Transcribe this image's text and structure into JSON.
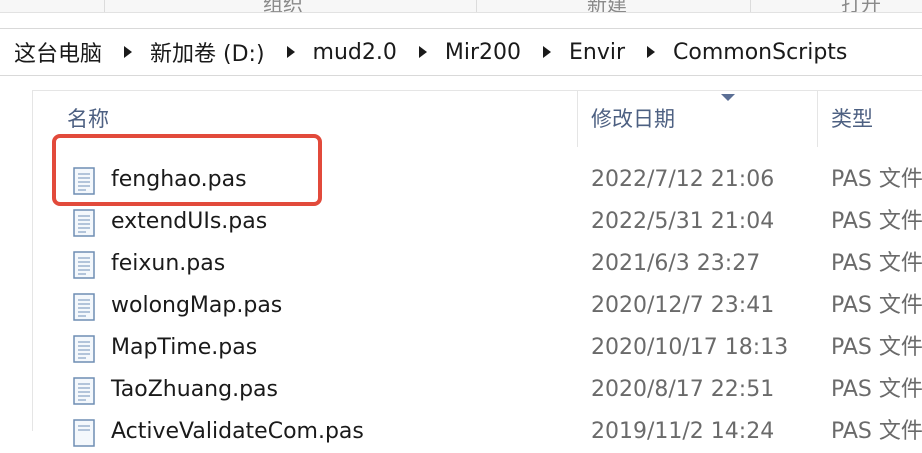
{
  "ribbon": {
    "groups": [
      {
        "label": "组织"
      },
      {
        "label": "新建"
      },
      {
        "label": "打开"
      }
    ]
  },
  "address": {
    "crumbs": [
      "这台电脑",
      "新加卷 (D:)",
      "mud2.0",
      "Mir200",
      "Envir",
      "CommonScripts"
    ]
  },
  "columns": {
    "name": "名称",
    "date": "修改日期",
    "type": "类型"
  },
  "files": [
    {
      "name": "fenghao.pas",
      "date": "2022/7/12 21:06",
      "type": "PAS 文件"
    },
    {
      "name": "extendUIs.pas",
      "date": "2022/5/31 21:04",
      "type": "PAS 文件"
    },
    {
      "name": "feixun.pas",
      "date": "2021/6/3 23:27",
      "type": "PAS 文件"
    },
    {
      "name": "wolongMap.pas",
      "date": "2020/12/7 23:41",
      "type": "PAS 文件"
    },
    {
      "name": "MapTime.pas",
      "date": "2020/10/17 18:13",
      "type": "PAS 文件"
    },
    {
      "name": "TaoZhuang.pas",
      "date": "2020/8/17 22:51",
      "type": "PAS 文件"
    },
    {
      "name": "ActiveValidateCom.pas",
      "date": "2019/11/2 14:24",
      "type": "PAS 文件"
    }
  ],
  "colors": {
    "highlight": "#e24a3b",
    "header_text": "#4d6082"
  }
}
